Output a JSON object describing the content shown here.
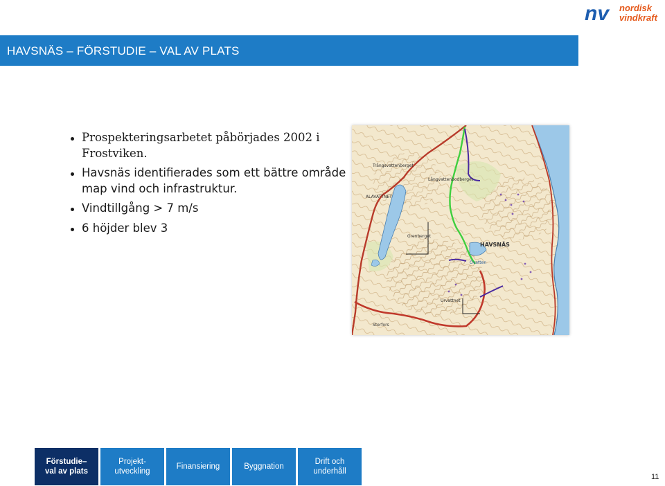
{
  "logo": {
    "brand_short": "nv",
    "brand_line1": "nordisk",
    "brand_line2": "vindkraft",
    "colors": {
      "blue": "#1e5eb0",
      "orange": "#e55a1c"
    }
  },
  "slide": {
    "title": "HAVSNÄS – FÖRSTUDIE – VAL AV PLATS",
    "page_number": "11"
  },
  "bullets": [
    "Prospekteringsarbetet påbörjades 2002 i Frostviken.",
    "Havsnäs identifierades som ett bättre område map vind och infrastruktur.",
    "Vindtillgång > 7 m/s",
    "6 höjder blev 3"
  ],
  "map": {
    "icon": "topographic-map",
    "labels": {
      "havsnas": "HAVSNÄS",
      "grenberget": "Grenberget",
      "trangsvattenberget": "Trångsvattenberget",
      "langvattenbodberget": "Långvattenbodberget",
      "alavattnet": "ALAVATTNET",
      "storfors": "Storfors",
      "urvattnet": "Urvattnet",
      "ovatten": "Övatten"
    }
  },
  "nav": [
    {
      "label": "Förstudie–\nval av plats",
      "active": true
    },
    {
      "label": "Projekt-\nutveckling",
      "active": false
    },
    {
      "label": "Finansiering",
      "active": false
    },
    {
      "label": "Byggnation",
      "active": false
    },
    {
      "label": "Drift och\nunderhåll",
      "active": false
    }
  ],
  "colors": {
    "title_bar": "#1e7cc6",
    "nav_active": "#0d2f66",
    "nav_inactive": "#1e7cc6"
  }
}
